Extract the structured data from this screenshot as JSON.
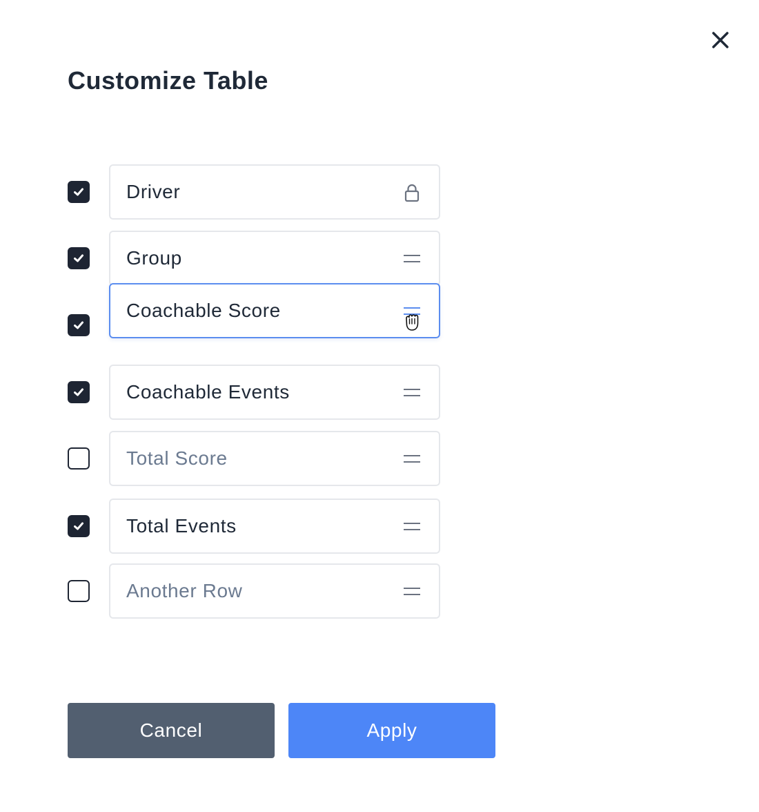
{
  "dialog": {
    "title": "Customize Table",
    "close_icon": "close-icon",
    "rows": [
      {
        "label": "Driver",
        "checked": true,
        "icon": "lock-icon"
      },
      {
        "label": "Group",
        "checked": true,
        "icon": "drag-handle-icon"
      },
      {
        "label": "Coachable Score",
        "checked": true,
        "icon": "drag-handle-icon",
        "state": "dragging"
      },
      {
        "label": "Coachable Events",
        "checked": true,
        "icon": "drag-handle-icon"
      },
      {
        "label": "Total Score",
        "checked": false,
        "icon": "drag-handle-icon"
      },
      {
        "label": "Total Events",
        "checked": true,
        "icon": "drag-handle-icon"
      },
      {
        "label": "Another Row",
        "checked": false,
        "icon": "drag-handle-icon"
      }
    ],
    "buttons": {
      "cancel_label": "Cancel",
      "apply_label": "Apply"
    }
  },
  "colors": {
    "checkbox_checked": "#1e2533",
    "dragging_border": "#5b8def",
    "cancel_button": "#525f70",
    "apply_button": "#4d86f7",
    "unchecked_text": "#6b7a90"
  }
}
